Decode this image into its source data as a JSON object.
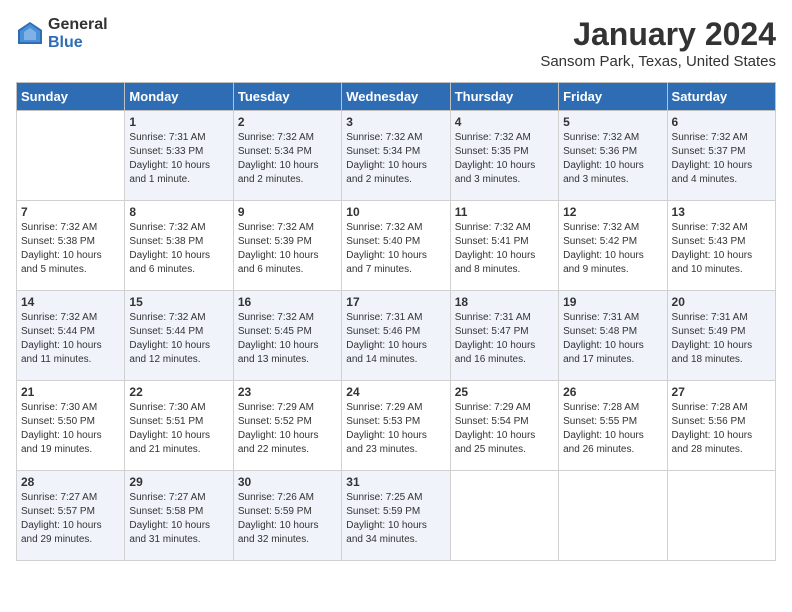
{
  "header": {
    "logo_general": "General",
    "logo_blue": "Blue",
    "title": "January 2024",
    "subtitle": "Sansom Park, Texas, United States"
  },
  "days_of_week": [
    "Sunday",
    "Monday",
    "Tuesday",
    "Wednesday",
    "Thursday",
    "Friday",
    "Saturday"
  ],
  "weeks": [
    [
      {
        "day": "",
        "content": ""
      },
      {
        "day": "1",
        "content": "Sunrise: 7:31 AM\nSunset: 5:33 PM\nDaylight: 10 hours\nand 1 minute."
      },
      {
        "day": "2",
        "content": "Sunrise: 7:32 AM\nSunset: 5:34 PM\nDaylight: 10 hours\nand 2 minutes."
      },
      {
        "day": "3",
        "content": "Sunrise: 7:32 AM\nSunset: 5:34 PM\nDaylight: 10 hours\nand 2 minutes."
      },
      {
        "day": "4",
        "content": "Sunrise: 7:32 AM\nSunset: 5:35 PM\nDaylight: 10 hours\nand 3 minutes."
      },
      {
        "day": "5",
        "content": "Sunrise: 7:32 AM\nSunset: 5:36 PM\nDaylight: 10 hours\nand 3 minutes."
      },
      {
        "day": "6",
        "content": "Sunrise: 7:32 AM\nSunset: 5:37 PM\nDaylight: 10 hours\nand 4 minutes."
      }
    ],
    [
      {
        "day": "7",
        "content": "Sunrise: 7:32 AM\nSunset: 5:38 PM\nDaylight: 10 hours\nand 5 minutes."
      },
      {
        "day": "8",
        "content": "Sunrise: 7:32 AM\nSunset: 5:38 PM\nDaylight: 10 hours\nand 6 minutes."
      },
      {
        "day": "9",
        "content": "Sunrise: 7:32 AM\nSunset: 5:39 PM\nDaylight: 10 hours\nand 6 minutes."
      },
      {
        "day": "10",
        "content": "Sunrise: 7:32 AM\nSunset: 5:40 PM\nDaylight: 10 hours\nand 7 minutes."
      },
      {
        "day": "11",
        "content": "Sunrise: 7:32 AM\nSunset: 5:41 PM\nDaylight: 10 hours\nand 8 minutes."
      },
      {
        "day": "12",
        "content": "Sunrise: 7:32 AM\nSunset: 5:42 PM\nDaylight: 10 hours\nand 9 minutes."
      },
      {
        "day": "13",
        "content": "Sunrise: 7:32 AM\nSunset: 5:43 PM\nDaylight: 10 hours\nand 10 minutes."
      }
    ],
    [
      {
        "day": "14",
        "content": "Sunrise: 7:32 AM\nSunset: 5:44 PM\nDaylight: 10 hours\nand 11 minutes."
      },
      {
        "day": "15",
        "content": "Sunrise: 7:32 AM\nSunset: 5:44 PM\nDaylight: 10 hours\nand 12 minutes."
      },
      {
        "day": "16",
        "content": "Sunrise: 7:32 AM\nSunset: 5:45 PM\nDaylight: 10 hours\nand 13 minutes."
      },
      {
        "day": "17",
        "content": "Sunrise: 7:31 AM\nSunset: 5:46 PM\nDaylight: 10 hours\nand 14 minutes."
      },
      {
        "day": "18",
        "content": "Sunrise: 7:31 AM\nSunset: 5:47 PM\nDaylight: 10 hours\nand 16 minutes."
      },
      {
        "day": "19",
        "content": "Sunrise: 7:31 AM\nSunset: 5:48 PM\nDaylight: 10 hours\nand 17 minutes."
      },
      {
        "day": "20",
        "content": "Sunrise: 7:31 AM\nSunset: 5:49 PM\nDaylight: 10 hours\nand 18 minutes."
      }
    ],
    [
      {
        "day": "21",
        "content": "Sunrise: 7:30 AM\nSunset: 5:50 PM\nDaylight: 10 hours\nand 19 minutes."
      },
      {
        "day": "22",
        "content": "Sunrise: 7:30 AM\nSunset: 5:51 PM\nDaylight: 10 hours\nand 21 minutes."
      },
      {
        "day": "23",
        "content": "Sunrise: 7:29 AM\nSunset: 5:52 PM\nDaylight: 10 hours\nand 22 minutes."
      },
      {
        "day": "24",
        "content": "Sunrise: 7:29 AM\nSunset: 5:53 PM\nDaylight: 10 hours\nand 23 minutes."
      },
      {
        "day": "25",
        "content": "Sunrise: 7:29 AM\nSunset: 5:54 PM\nDaylight: 10 hours\nand 25 minutes."
      },
      {
        "day": "26",
        "content": "Sunrise: 7:28 AM\nSunset: 5:55 PM\nDaylight: 10 hours\nand 26 minutes."
      },
      {
        "day": "27",
        "content": "Sunrise: 7:28 AM\nSunset: 5:56 PM\nDaylight: 10 hours\nand 28 minutes."
      }
    ],
    [
      {
        "day": "28",
        "content": "Sunrise: 7:27 AM\nSunset: 5:57 PM\nDaylight: 10 hours\nand 29 minutes."
      },
      {
        "day": "29",
        "content": "Sunrise: 7:27 AM\nSunset: 5:58 PM\nDaylight: 10 hours\nand 31 minutes."
      },
      {
        "day": "30",
        "content": "Sunrise: 7:26 AM\nSunset: 5:59 PM\nDaylight: 10 hours\nand 32 minutes."
      },
      {
        "day": "31",
        "content": "Sunrise: 7:25 AM\nSunset: 5:59 PM\nDaylight: 10 hours\nand 34 minutes."
      },
      {
        "day": "",
        "content": ""
      },
      {
        "day": "",
        "content": ""
      },
      {
        "day": "",
        "content": ""
      }
    ]
  ]
}
